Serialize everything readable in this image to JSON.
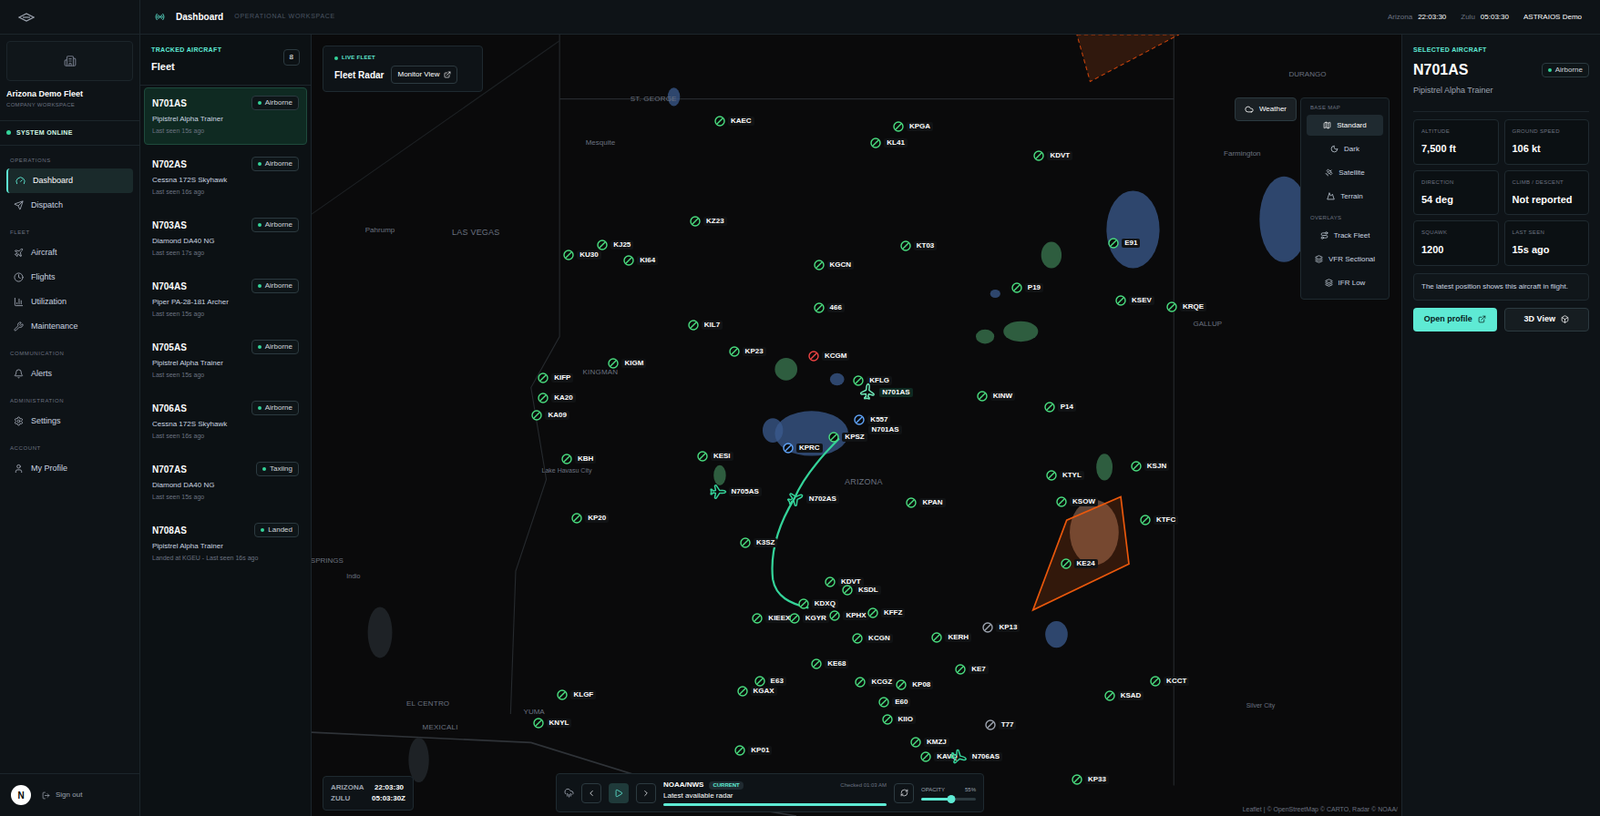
{
  "topbar": {
    "title": "Dashboard",
    "subtitle": "OPERATIONAL WORKSPACE",
    "clocks": [
      {
        "label": "Arizona",
        "time": "22:03:30"
      },
      {
        "label": "Zulu",
        "time": "05:03:30"
      }
    ],
    "account": "ASTRAIOS Demo"
  },
  "sidebar": {
    "workspace": "Arizona Demo Fleet",
    "workspace_kind": "COMPANY WORKSPACE",
    "status": "SYSTEM ONLINE",
    "groups": [
      {
        "title": "OPERATIONS",
        "items": [
          {
            "label": "Dashboard",
            "selected": true
          },
          {
            "label": "Dispatch",
            "selected": false
          }
        ]
      },
      {
        "title": "FLEET",
        "items": [
          {
            "label": "Aircraft",
            "selected": false
          },
          {
            "label": "Flights",
            "selected": false
          },
          {
            "label": "Utilization",
            "selected": false
          },
          {
            "label": "Maintenance",
            "selected": false
          }
        ]
      },
      {
        "title": "COMMUNICATION",
        "items": [
          {
            "label": "Alerts",
            "selected": false
          }
        ]
      },
      {
        "title": "ADMINISTRATION",
        "items": [
          {
            "label": "Settings",
            "selected": false
          }
        ]
      },
      {
        "title": "ACCOUNT",
        "items": [
          {
            "label": "My Profile",
            "selected": false
          }
        ]
      }
    ],
    "avatar": "N",
    "sign_out": "Sign out"
  },
  "fleet": {
    "eyebrow": "TRACKED AIRCRAFT",
    "title": "Fleet",
    "count": "8",
    "items": [
      {
        "reg": "N701AS",
        "status": "Airborne",
        "type": "Pipistrel Alpha Trainer",
        "seen": "Last seen 15s ago",
        "selected": true
      },
      {
        "reg": "N702AS",
        "status": "Airborne",
        "type": "Cessna 172S Skyhawk",
        "seen": "Last seen 16s ago",
        "selected": false
      },
      {
        "reg": "N703AS",
        "status": "Airborne",
        "type": "Diamond DA40 NG",
        "seen": "Last seen 17s ago",
        "selected": false
      },
      {
        "reg": "N704AS",
        "status": "Airborne",
        "type": "Piper PA-28-181 Archer",
        "seen": "Last seen 15s ago",
        "selected": false
      },
      {
        "reg": "N705AS",
        "status": "Airborne",
        "type": "Pipistrel Alpha Trainer",
        "seen": "Last seen 15s ago",
        "selected": false
      },
      {
        "reg": "N706AS",
        "status": "Airborne",
        "type": "Cessna 172S Skyhawk",
        "seen": "Last seen 16s ago",
        "selected": false
      },
      {
        "reg": "N707AS",
        "status": "Taxiing",
        "type": "Diamond DA40 NG",
        "seen": "Last seen 15s ago",
        "selected": false
      },
      {
        "reg": "N708AS",
        "status": "Landed",
        "type": "Pipistrel Alpha Trainer",
        "seen": "Landed at KGEU - Last seen 16s ago",
        "selected": false
      }
    ]
  },
  "map": {
    "card": {
      "eyebrow": "LIVE FLEET",
      "title": "Fleet Radar",
      "button": "Monitor View"
    },
    "layers": {
      "weather": "Weather",
      "base_title": "BASE MAP",
      "base": [
        {
          "label": "Standard",
          "selected": true
        },
        {
          "label": "Dark",
          "selected": false
        },
        {
          "label": "Satellite",
          "selected": false
        },
        {
          "label": "Terrain",
          "selected": false
        }
      ],
      "overlay_title": "OVERLAYS",
      "overlays": [
        "Track Fleet",
        "VFR Sectional",
        "IFR Low"
      ]
    },
    "places": [
      "ST. GEORGE",
      "Mesquite",
      "LAS VEGAS",
      "Pahrump",
      "KINGMAN",
      "Lake Havasu City",
      "ARIZONA",
      "GALLUP",
      "Farmington",
      "DURANGO",
      "EL CENTRO",
      "MEXICALI",
      "YUMA",
      "SPRINGS",
      "Indio",
      "Silver City"
    ],
    "airports": [
      {
        "id": "KAEC",
        "color": "#4ade80"
      },
      {
        "id": "KPGA",
        "color": "#4ade80"
      },
      {
        "id": "KL41",
        "color": "#4ade80"
      },
      {
        "id": "KDVT",
        "color": "#4ade80"
      },
      {
        "id": "KZ23",
        "color": "#4ade80"
      },
      {
        "id": "KU30",
        "color": "#4ade80"
      },
      {
        "id": "KJ25",
        "color": "#4ade80"
      },
      {
        "id": "KI64",
        "color": "#4ade80"
      },
      {
        "id": "KT03",
        "color": "#4ade80"
      },
      {
        "id": "KGCN",
        "color": "#4ade80"
      },
      {
        "id": "E91",
        "color": "#4ade80"
      },
      {
        "id": "P19",
        "color": "#4ade80"
      },
      {
        "id": "KSEV",
        "color": "#4ade80"
      },
      {
        "id": "KRQE",
        "color": "#4ade80"
      },
      {
        "id": "466",
        "color": "#4ade80"
      },
      {
        "id": "KIL7",
        "color": "#4ade80"
      },
      {
        "id": "KP23",
        "color": "#4ade80"
      },
      {
        "id": "KCGM",
        "color": "#ef4444"
      },
      {
        "id": "KFLG",
        "color": "#4ade80"
      },
      {
        "id": "KIGM",
        "color": "#4ade80"
      },
      {
        "id": "KIFP",
        "color": "#4ade80"
      },
      {
        "id": "KA20",
        "color": "#4ade80"
      },
      {
        "id": "KA09",
        "color": "#4ade80"
      },
      {
        "id": "KINW",
        "color": "#4ade80"
      },
      {
        "id": "P14",
        "color": "#4ade80"
      },
      {
        "id": "K557",
        "color": "#60a5fa"
      },
      {
        "id": "KPSZ",
        "color": "#4ade80"
      },
      {
        "id": "KPRC",
        "color": "#60a5fa"
      },
      {
        "id": "KESI",
        "color": "#4ade80"
      },
      {
        "id": "KBH",
        "color": "#4ade80"
      },
      {
        "id": "KTYL",
        "color": "#4ade80"
      },
      {
        "id": "KSJN",
        "color": "#4ade80"
      },
      {
        "id": "KPAN",
        "color": "#4ade80"
      },
      {
        "id": "KSOW",
        "color": "#4ade80"
      },
      {
        "id": "KTFC",
        "color": "#4ade80"
      },
      {
        "id": "KP20",
        "color": "#4ade80"
      },
      {
        "id": "K3SZ",
        "color": "#4ade80"
      },
      {
        "id": "KE24",
        "color": "#4ade80"
      },
      {
        "id": "KDVT",
        "color": "#4ade80"
      },
      {
        "id": "KSDL",
        "color": "#4ade80"
      },
      {
        "id": "KDXQ",
        "color": "#4ade80"
      },
      {
        "id": "KIEEX",
        "color": "#4ade80"
      },
      {
        "id": "KGYR",
        "color": "#4ade80"
      },
      {
        "id": "KPHX",
        "color": "#4ade80"
      },
      {
        "id": "KFFZ",
        "color": "#4ade80"
      },
      {
        "id": "KCGN",
        "color": "#4ade80"
      },
      {
        "id": "KERH",
        "color": "#4ade80"
      },
      {
        "id": "KP13",
        "color": "#9ca3af"
      },
      {
        "id": "KE7",
        "color": "#4ade80"
      },
      {
        "id": "KE68",
        "color": "#4ade80"
      },
      {
        "id": "E63",
        "color": "#4ade80"
      },
      {
        "id": "KCGZ",
        "color": "#4ade80"
      },
      {
        "id": "KP08",
        "color": "#4ade80"
      },
      {
        "id": "KGAX",
        "color": "#4ade80"
      },
      {
        "id": "KSAD",
        "color": "#4ade80"
      },
      {
        "id": "KCCT",
        "color": "#4ade80"
      },
      {
        "id": "E60",
        "color": "#4ade80"
      },
      {
        "id": "KLGF",
        "color": "#4ade80"
      },
      {
        "id": "KNYL",
        "color": "#4ade80"
      },
      {
        "id": "KIIO",
        "color": "#4ade80"
      },
      {
        "id": "T77",
        "color": "#9ca3af"
      },
      {
        "id": "KP01",
        "color": "#4ade80"
      },
      {
        "id": "KMZJ",
        "color": "#4ade80"
      },
      {
        "id": "KAVQ",
        "color": "#4ade80"
      },
      {
        "id": "KP33",
        "color": "#4ade80"
      }
    ],
    "aircraft": [
      {
        "reg": "N701AS",
        "selected": true
      },
      {
        "reg": "N705AS",
        "selected": false
      },
      {
        "reg": "N702AS",
        "selected": false
      },
      {
        "reg": "N706AS",
        "selected": false
      }
    ],
    "selected_marker": "N701AS",
    "clock": [
      {
        "label": "ARIZONA",
        "time": "22:03:30"
      },
      {
        "label": "ZULU",
        "time": "05:03:30Z"
      }
    ],
    "radar": {
      "source": "NOAA/NWS",
      "badge": "CURRENT",
      "caption": "Latest available radar",
      "checked": "Checked 01:03 AM",
      "progress": 1,
      "opacity_label": "OPACITY",
      "opacity": "55%",
      "opacity_level": 0.55
    },
    "attribution": "Leaflet | © OpenStreetMap © CARTO, Radar © NOAA/"
  },
  "details": {
    "eyebrow": "SELECTED AIRCRAFT",
    "reg": "N701AS",
    "status": "Airborne",
    "type": "Pipistrel Alpha Trainer",
    "stats": [
      {
        "label": "ALTITUDE",
        "value": "7,500 ft"
      },
      {
        "label": "GROUND SPEED",
        "value": "106 kt"
      },
      {
        "label": "DIRECTION",
        "value": "54 deg"
      },
      {
        "label": "CLIMB / DESCENT",
        "value": "Not reported"
      },
      {
        "label": "SQUAWK",
        "value": "1200"
      },
      {
        "label": "LAST SEEN",
        "value": "15s ago"
      }
    ],
    "note": "The latest position shows this aircraft in flight.",
    "primary": "Open profile",
    "secondary": "3D View"
  }
}
